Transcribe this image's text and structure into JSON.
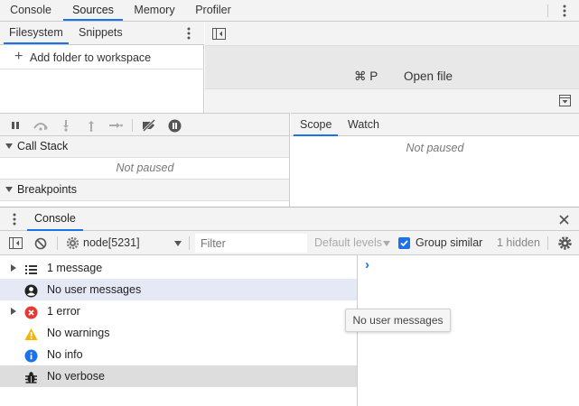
{
  "top_tabs": [
    {
      "label": "Console",
      "active": false
    },
    {
      "label": "Sources",
      "active": true
    },
    {
      "label": "Memory",
      "active": false
    },
    {
      "label": "Profiler",
      "active": false
    }
  ],
  "navigator": {
    "tabs": [
      {
        "label": "Filesystem",
        "active": true
      },
      {
        "label": "Snippets",
        "active": false
      }
    ],
    "add_folder_label": "Add folder to workspace"
  },
  "editor": {
    "shortcut": "⌘ P",
    "open_file_label": "Open file"
  },
  "debugger": {
    "call_stack_label": "Call Stack",
    "call_stack_status": "Not paused",
    "breakpoints_label": "Breakpoints"
  },
  "sidebar": {
    "tabs": [
      {
        "label": "Scope",
        "active": true
      },
      {
        "label": "Watch",
        "active": false
      }
    ],
    "status": "Not paused"
  },
  "drawer": {
    "tab_label": "Console"
  },
  "console_toolbar": {
    "context": "node[5231]",
    "filter_placeholder": "Filter",
    "levels_label": "Default levels",
    "group_similar_label": "Group similar",
    "group_similar_checked": true,
    "hidden_count": "1 hidden"
  },
  "messages": [
    {
      "label": "1 message",
      "icon": "list-icon",
      "expandable": true
    },
    {
      "label": "No user messages",
      "icon": "user-icon",
      "expandable": false
    },
    {
      "label": "1 error",
      "icon": "error-icon",
      "expandable": true
    },
    {
      "label": "No warnings",
      "icon": "warning-icon",
      "expandable": false
    },
    {
      "label": "No info",
      "icon": "info-icon",
      "expandable": false
    },
    {
      "label": "No verbose",
      "icon": "bug-icon",
      "expandable": false
    }
  ],
  "prompt_symbol": "›",
  "tooltip": "No user messages",
  "colors": {
    "accent": "#1a73e8",
    "error": "#e53935",
    "warning": "#f4b400",
    "info": "#1a73e8"
  }
}
